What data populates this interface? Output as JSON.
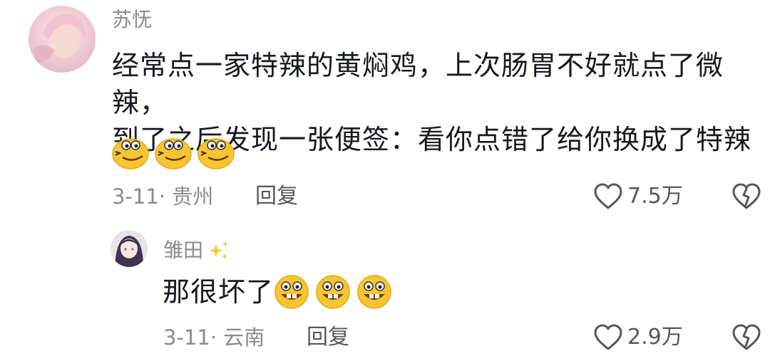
{
  "comment1": {
    "username": "苏怃",
    "text_line1": "经常点一家特辣的黄焖鸡，上次肠胃不好就点了微辣，",
    "text_line2": "到了之后发现一张便签：看你点错了给你换成了特辣",
    "emoji_icons": [
      "smirk-face-emoji-icon",
      "smirk-face-emoji-icon",
      "smirk-face-emoji-icon"
    ],
    "meta": "3-11· 贵州",
    "reply_label": "回复",
    "likes": "7.5万"
  },
  "comment2": {
    "username": "雏田",
    "sparkle_icon": "sparkles-icon",
    "text": "那很坏了",
    "emoji_icons": [
      "grin-face-emoji-icon",
      "grin-face-emoji-icon",
      "grin-face-emoji-icon"
    ],
    "meta": "3-11· 云南",
    "reply_label": "回复",
    "likes": "2.9万"
  },
  "colors": {
    "text": "#161823",
    "secondary": "#8a8b91",
    "action": "#545760",
    "emoji_yellow": "#f7c531"
  }
}
